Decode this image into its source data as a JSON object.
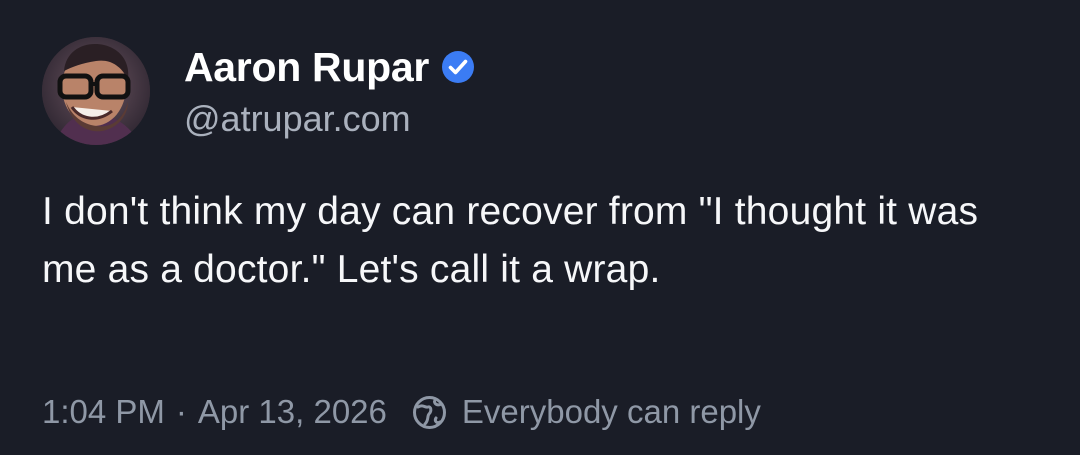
{
  "author": {
    "display_name": "Aaron Rupar",
    "handle": "@atrupar.com",
    "verified_icon": "verified-check-icon",
    "avatar_icon": "avatar"
  },
  "post": {
    "text": "I don't think my day can recover from \"I thought it was me as a doctor.\" Let's call it a wrap."
  },
  "meta": {
    "time": "1:04 PM",
    "separator": "·",
    "date": "Apr 13, 2026",
    "reply_setting_icon": "globe-icon",
    "reply_setting": "Everybody can reply"
  },
  "colors": {
    "background": "#1a1d27",
    "text_primary": "#ffffff",
    "text_secondary": "#8f98a6",
    "verified_blue": "#3b7cf4"
  }
}
